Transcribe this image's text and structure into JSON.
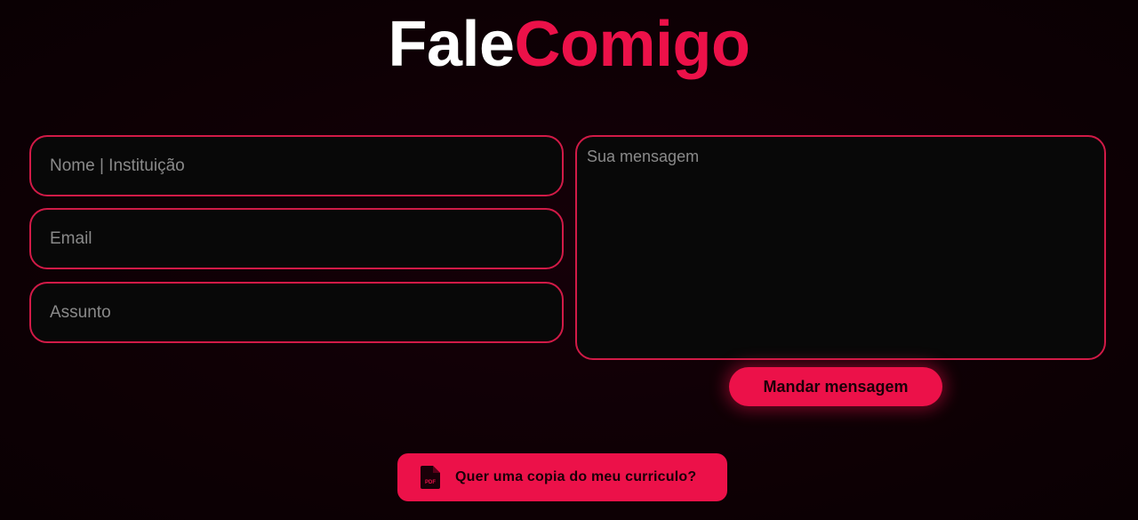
{
  "header": {
    "title_part1": "Fale",
    "title_part2": "Comigo"
  },
  "form": {
    "name_placeholder": "Nome | Instituição",
    "email_placeholder": "Email",
    "subject_placeholder": "Assunto",
    "message_placeholder": "Sua mensagem",
    "submit_label": "Mandar mensagem"
  },
  "resume": {
    "label": "Quer uma copia do meu curriculo?",
    "icon": "pdf-file-icon",
    "icon_text": "PDF"
  },
  "colors": {
    "accent": "#ec1149",
    "background": "#0e0005",
    "field_background": "#080808",
    "field_border": "#d11a47"
  }
}
